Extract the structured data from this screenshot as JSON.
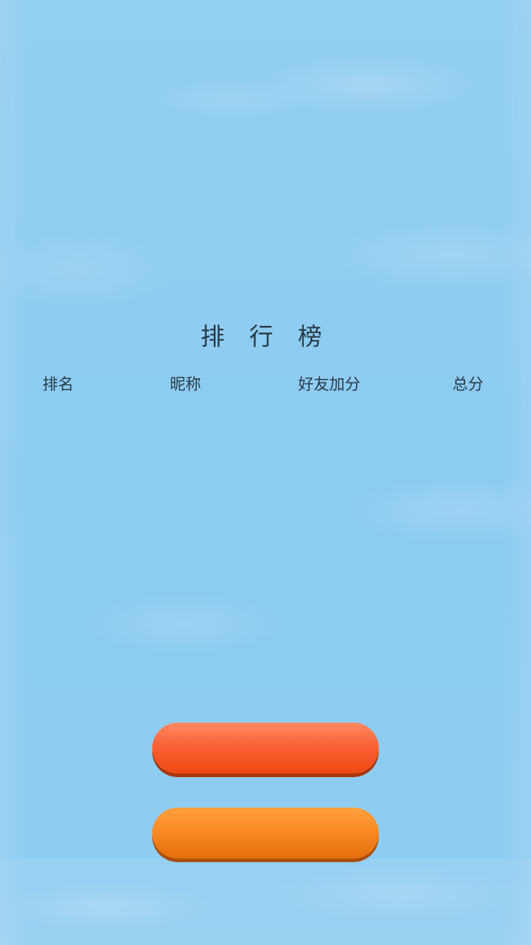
{
  "title": "排 行 榜",
  "table": {
    "headers": {
      "rank": "排名",
      "nickname": "昵称",
      "friend_bonus": "好友加分",
      "total": "总分"
    },
    "rows": []
  },
  "buttons": {
    "primary": {
      "label": "",
      "color": "#fb6337"
    },
    "secondary": {
      "label": "",
      "color": "#f98b25"
    }
  },
  "colors": {
    "background": "#8fcdf1",
    "text": "#2b3a44"
  }
}
